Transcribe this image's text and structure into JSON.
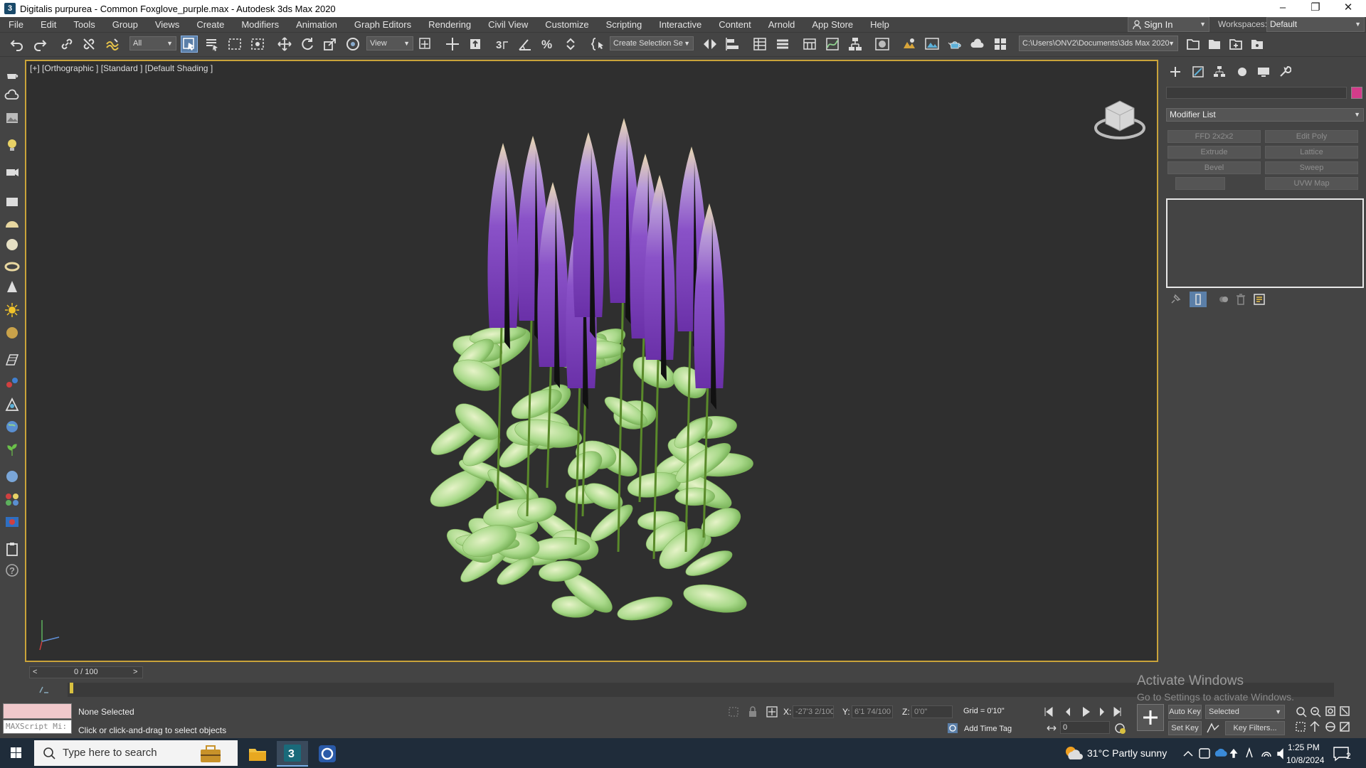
{
  "window": {
    "title": "Digitalis purpurea - Common Foxglove_purple.max - Autodesk 3ds Max 2020",
    "app_icon": "3"
  },
  "menu": [
    "File",
    "Edit",
    "Tools",
    "Group",
    "Views",
    "Create",
    "Modifiers",
    "Animation",
    "Graph Editors",
    "Rendering",
    "Civil View",
    "Customize",
    "Scripting",
    "Interactive",
    "Content",
    "Arnold",
    "App Store",
    "Help"
  ],
  "signin": {
    "label": "Sign In"
  },
  "workspace": {
    "label": "Workspaces:",
    "value": "Default"
  },
  "toolbar": {
    "filter": "All",
    "refcoord": "View",
    "named_selection": "Create Selection Se",
    "path": "C:\\Users\\ONV2\\Documents\\3ds Max 2020"
  },
  "viewport": {
    "label": "[+] [Orthographic ] [Standard ] [Default Shading ]"
  },
  "command_panel": {
    "modifier_list": "Modifier List",
    "buttons": [
      "FFD 2x2x2",
      "Edit Poly",
      "Extrude",
      "Lattice",
      "Bevel",
      "Sweep",
      "",
      "UVW Map"
    ],
    "object_color": "#d23c8a"
  },
  "timeline": {
    "frame": "0 / 100",
    "prev": "<",
    "next": ">"
  },
  "status": {
    "selection": "None Selected",
    "prompt": "Click or click-and-drag to select objects",
    "maxscript": "MAXScript Mi:",
    "x_label": "X:",
    "x_value": "-27'3 2/100",
    "y_label": "Y:",
    "y_value": "6'1 74/100",
    "z_label": "Z:",
    "z_value": "0'0\"",
    "grid": "Grid = 0'10\"",
    "add_time_tag": "Add Time Tag",
    "auto_key": "Auto Key",
    "set_key": "Set Key",
    "selected": "Selected",
    "key_filters": "Key Filters...",
    "frame_field": "0"
  },
  "activation": {
    "line1": "Activate Windows",
    "line2": "Go to Settings to activate Windows."
  },
  "taskbar": {
    "search": "Type here to search",
    "weather": "31°C  Partly sunny",
    "time": "1:25 PM",
    "date": "10/8/2024",
    "notifications": "2"
  }
}
